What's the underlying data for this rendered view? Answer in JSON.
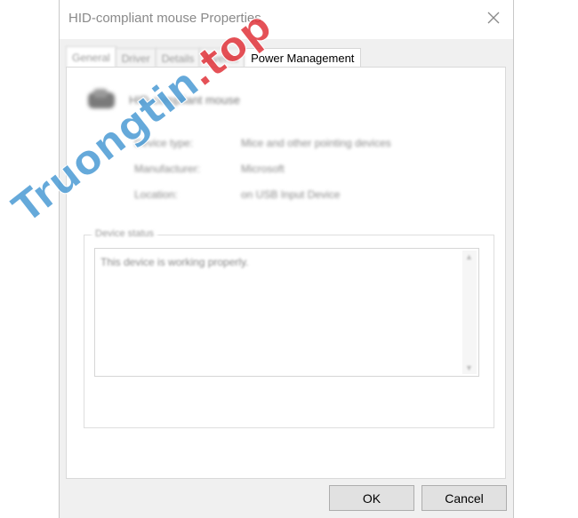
{
  "window": {
    "title": "HID-compliant mouse Properties"
  },
  "tabs": [
    {
      "label": "General",
      "active": true
    },
    {
      "label": "Driver"
    },
    {
      "label": "Details"
    },
    {
      "label": "Events"
    },
    {
      "label": "Power Management"
    }
  ],
  "device": {
    "name": "HID-compliant mouse",
    "icon": "mouse-icon",
    "properties": [
      {
        "label": "Device type:",
        "value": "Mice and other pointing devices"
      },
      {
        "label": "Manufacturer:",
        "value": "Microsoft"
      },
      {
        "label": "Location:",
        "value": "on USB Input Device"
      }
    ]
  },
  "status": {
    "legend": "Device status",
    "text": "This device is working properly."
  },
  "buttons": {
    "ok": "OK",
    "cancel": "Cancel"
  },
  "watermark": {
    "text": "Truongtin.top",
    "color": "#4a9ad4",
    "accent": "#e0333a"
  }
}
